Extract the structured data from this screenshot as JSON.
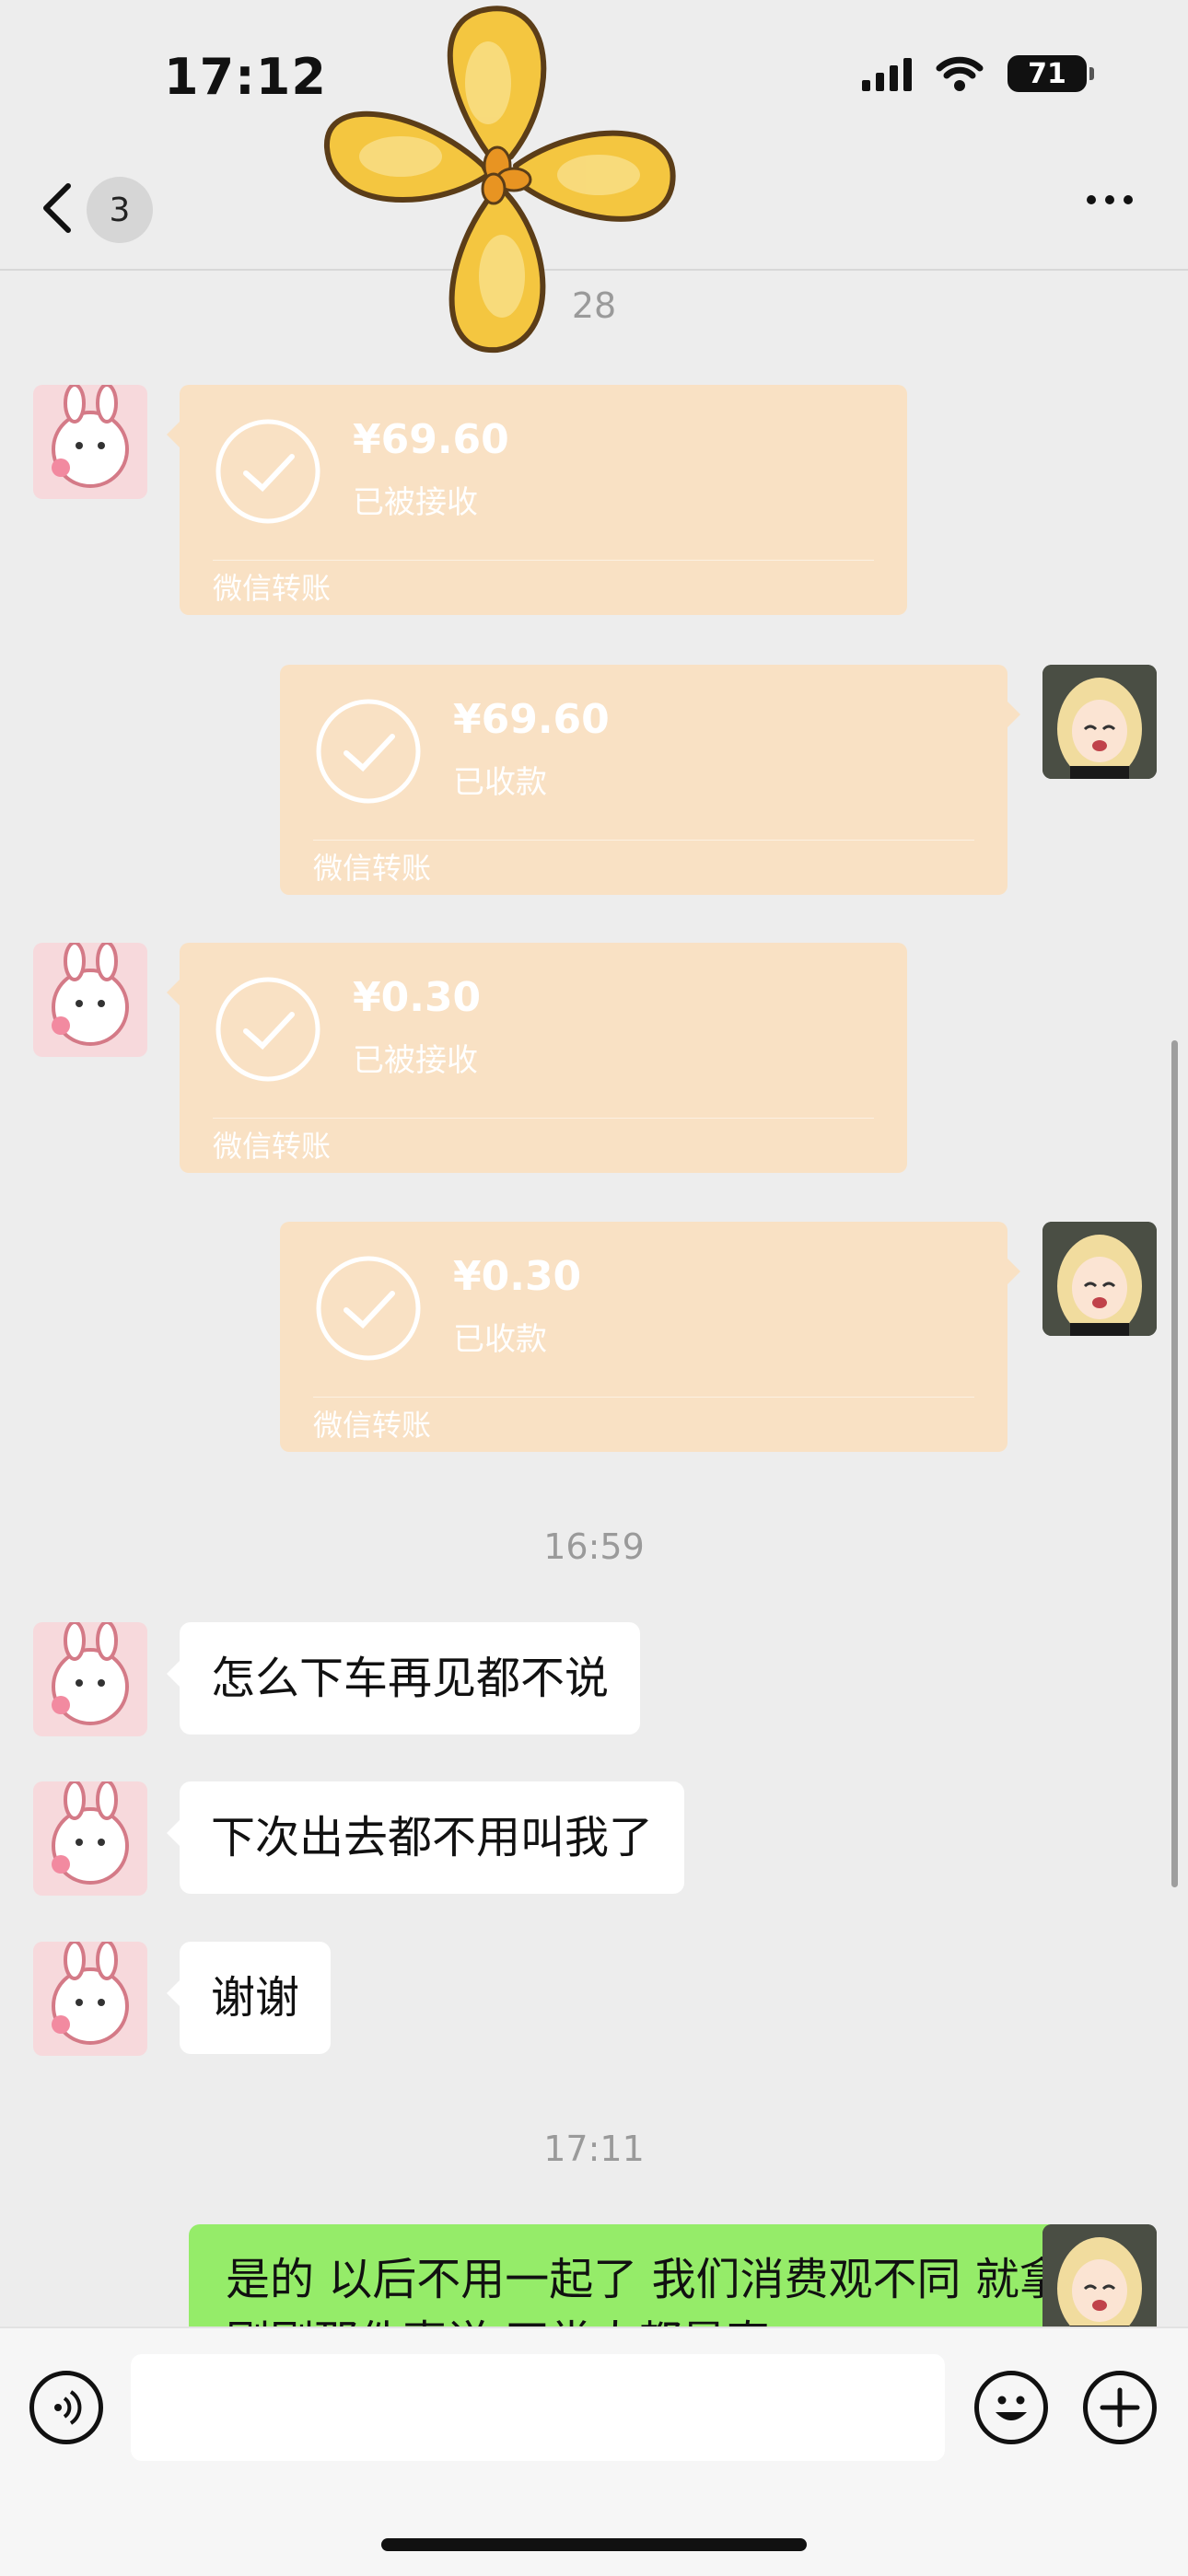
{
  "status_bar": {
    "time": "17:12",
    "battery": "71"
  },
  "nav": {
    "unread_count": "3"
  },
  "timestamps": {
    "t1": "28",
    "t2": "16:59",
    "t3": "17:11"
  },
  "transfers": [
    {
      "amount": "¥69.60",
      "state": "已被接收",
      "label": "微信转账"
    },
    {
      "amount": "¥69.60",
      "state": "已收款",
      "label": "微信转账"
    },
    {
      "amount": "¥0.30",
      "state": "已被接收",
      "label": "微信转账"
    },
    {
      "amount": "¥0.30",
      "state": "已收款",
      "label": "微信转账"
    }
  ],
  "messages": [
    {
      "text": "怎么下车再见都不说"
    },
    {
      "text": "下次出去都不用叫我了"
    },
    {
      "text": "谢谢"
    },
    {
      "text": "是的 以后不用一起了 我们消费观不同 就拿刚刚那件事说 正常人都是直"
    }
  ],
  "input": {
    "placeholder": ""
  },
  "colors": {
    "transfer_bg": "#f9e1c4",
    "my_bubble": "#95ec69",
    "background": "#ededed"
  },
  "icons": [
    "back-chevron-icon",
    "more-dots-icon",
    "check-circle-icon",
    "voice-icon",
    "emoji-icon",
    "plus-icon",
    "flower-sticker-icon"
  ]
}
